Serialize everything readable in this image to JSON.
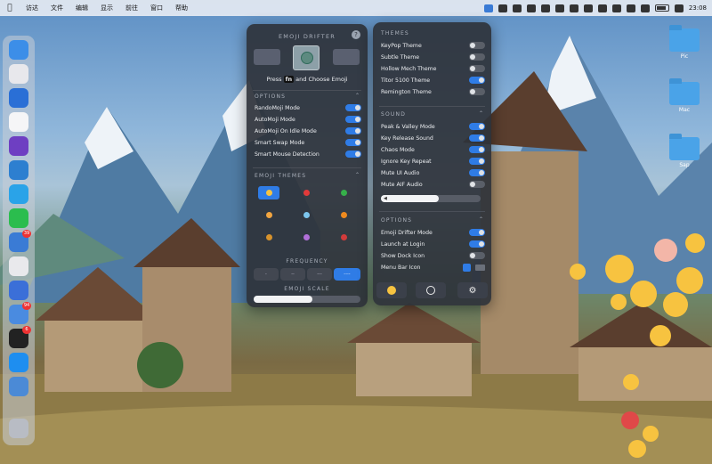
{
  "menubar": {
    "apple": "",
    "items": [
      "访达",
      "文件",
      "编辑",
      "显示",
      "前往",
      "窗口",
      "帮助"
    ],
    "clock": "23:08"
  },
  "desktop": {
    "folders": [
      "Pic",
      "Mac",
      "Sap"
    ]
  },
  "dock": {
    "badges": [
      "39",
      "94",
      "6"
    ]
  },
  "emoji_drifter": {
    "title": "EMOJI DRIFTER",
    "help": "?",
    "press_text_before": "Press",
    "press_key": "fn",
    "press_text_after": "and Choose Emoji",
    "options_header": "OPTIONS",
    "options": [
      {
        "label": "RandoMoji Mode",
        "on": true
      },
      {
        "label": "AutoMoji Mode",
        "on": true
      },
      {
        "label": "AutoMoji On Idle Mode",
        "on": true
      },
      {
        "label": "Smart Swap Mode",
        "on": true
      },
      {
        "label": "Smart Mouse Detection",
        "on": true
      }
    ],
    "emoji_themes_header": "EMOJI THEMES",
    "emoji_themes": [
      "😀",
      "❤️",
      "🟢",
      "🐱",
      "❄️",
      "🎃",
      "🍔",
      "🦄",
      "🎁"
    ],
    "frequency_header": "FREQUENCY",
    "frequency_options": [
      "·",
      "··",
      "···",
      "····"
    ],
    "scale_header": "EMOJI SCALE",
    "scale_value": 0.55
  },
  "settings": {
    "themes_header": "THEMES",
    "themes": [
      {
        "label": "KeyPop Theme",
        "on": false
      },
      {
        "label": "Subtle Theme",
        "on": false
      },
      {
        "label": "Hollow Mech Theme",
        "on": false
      },
      {
        "label": "Titor 5100 Theme",
        "on": true
      },
      {
        "label": "Remington Theme",
        "on": false
      }
    ],
    "sound_header": "SOUND",
    "sound": [
      {
        "label": "Peak & Valley Mode",
        "on": true
      },
      {
        "label": "Key Release Sound",
        "on": true
      },
      {
        "label": "Chaos Mode",
        "on": true
      },
      {
        "label": "Ignore Key Repeat",
        "on": true
      },
      {
        "label": "Mute UI Audio",
        "on": true
      },
      {
        "label": "Mute AIF Audio",
        "on": false
      }
    ],
    "volume_value": 0.58,
    "options_header": "OPTIONS",
    "options": [
      {
        "label": "Emoji Drifter Mode",
        "on": true
      },
      {
        "label": "Launch at Login",
        "on": true
      },
      {
        "label": "Show Dock Icon",
        "on": false
      },
      {
        "label": "Menu Bar Icon",
        "on": null
      }
    ]
  },
  "colors": {
    "accent": "#2f7ce6",
    "panel": "#2e323a"
  }
}
